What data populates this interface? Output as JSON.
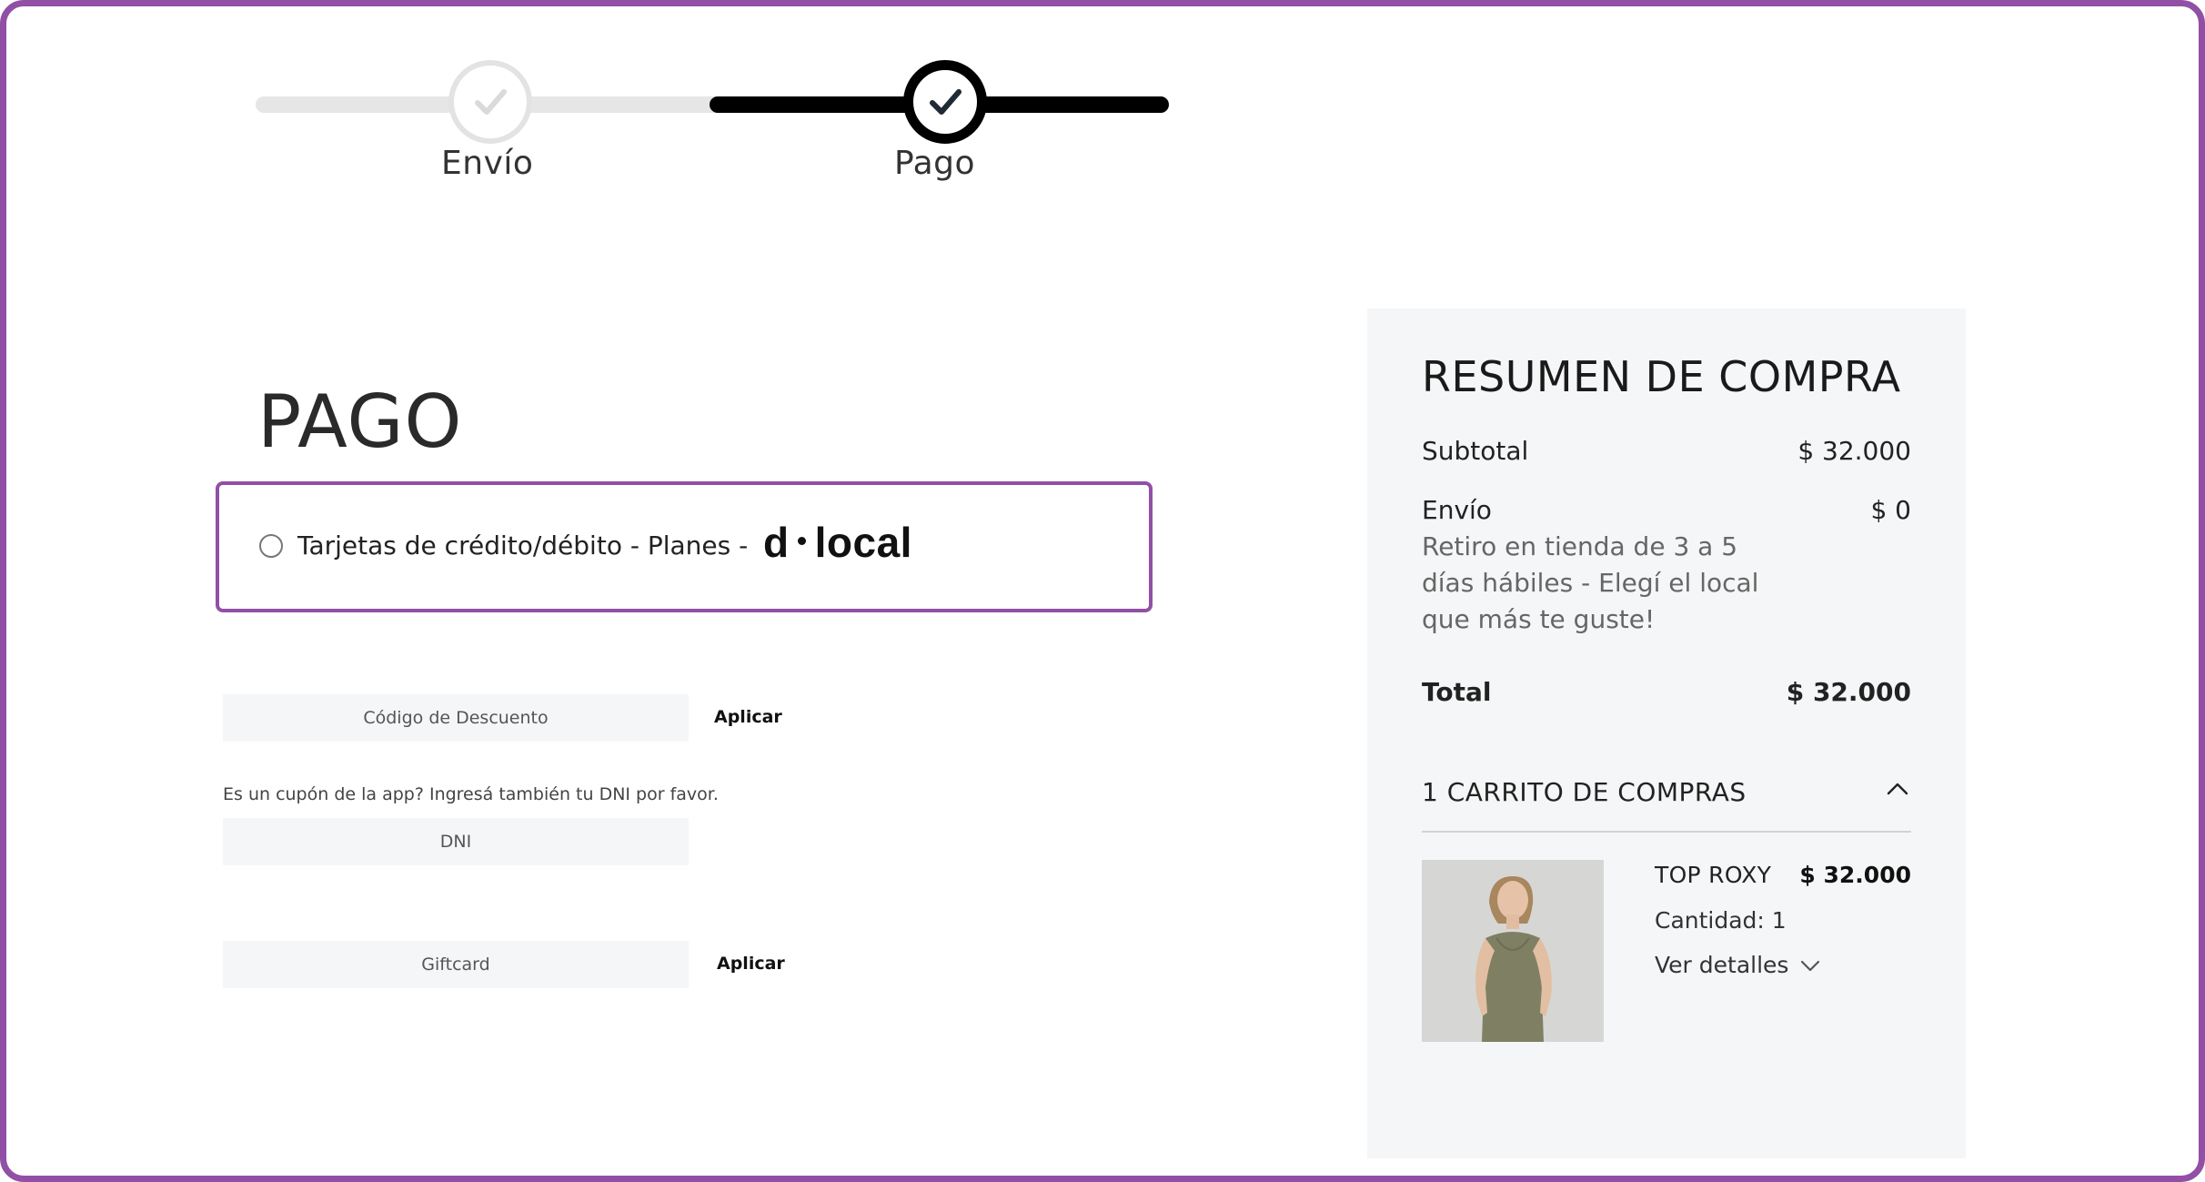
{
  "stepper": {
    "steps": [
      {
        "label": "Envío",
        "status": "completed"
      },
      {
        "label": "Pago",
        "status": "active"
      }
    ]
  },
  "main": {
    "title": "PAGO",
    "payment_method": {
      "label": "Tarjetas de crédito/débito - Planes -",
      "logo_text_left": "d",
      "logo_text_right": "local",
      "logo_name": "dlocal-logo",
      "selected": false
    },
    "discount": {
      "placeholder": "Código de Descuento",
      "apply_label": "Aplicar"
    },
    "coupon_note": "Es un cupón de la app? Ingresá también tu DNI por favor.",
    "dni": {
      "placeholder": "DNI"
    },
    "giftcard": {
      "placeholder": "Giftcard",
      "apply_label": "Aplicar"
    }
  },
  "summary": {
    "title": "RESUMEN DE COMPRA",
    "subtotal_label": "Subtotal",
    "subtotal_value": "$ 32.000",
    "shipping_label": "Envío",
    "shipping_value": "$ 0",
    "shipping_note": "Retiro en tienda de 3 a 5 días hábiles - Elegí el local que más te guste!",
    "total_label": "Total",
    "total_value": "$ 32.000",
    "cart_heading": "1 CARRITO DE COMPRAS",
    "items": [
      {
        "name": "TOP ROXY",
        "price": "$ 32.000",
        "quantity": "Cantidad: 1",
        "details_label": "Ver detalles"
      }
    ]
  },
  "colors": {
    "accent": "#9150a6",
    "active_step": "#000000",
    "completed_step": "#e3e3e3",
    "summary_bg": "#f5f6f7"
  },
  "icons": [
    "check-icon",
    "radio-icon",
    "chevron-up-icon",
    "chevron-down-icon"
  ]
}
